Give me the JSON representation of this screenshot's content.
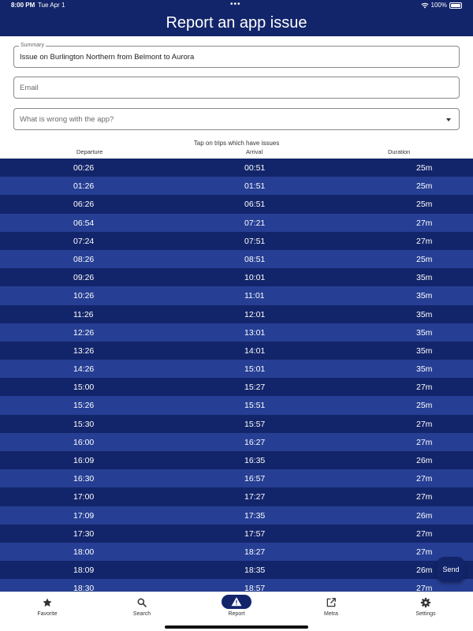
{
  "status_bar": {
    "time": "8:00 PM",
    "date": "Tue Apr 1",
    "dots": "•••",
    "battery": "100%"
  },
  "header": {
    "title": "Report an app issue"
  },
  "form": {
    "summary": {
      "label": "Summary",
      "value": "Issue on Burlington Northern from Belmont to Aurora"
    },
    "email": {
      "placeholder": "Email"
    },
    "issue": {
      "placeholder": "What is wrong with the app?"
    }
  },
  "trips": {
    "hint": "Tap on trips which have issues",
    "columns": {
      "departure": "Departure",
      "arrival": "Arrival",
      "duration": "Duration"
    },
    "rows": [
      {
        "departure": "00:26",
        "arrival": "00:51",
        "duration": "25m"
      },
      {
        "departure": "01:26",
        "arrival": "01:51",
        "duration": "25m"
      },
      {
        "departure": "06:26",
        "arrival": "06:51",
        "duration": "25m"
      },
      {
        "departure": "06:54",
        "arrival": "07:21",
        "duration": "27m"
      },
      {
        "departure": "07:24",
        "arrival": "07:51",
        "duration": "27m"
      },
      {
        "departure": "08:26",
        "arrival": "08:51",
        "duration": "25m"
      },
      {
        "departure": "09:26",
        "arrival": "10:01",
        "duration": "35m"
      },
      {
        "departure": "10:26",
        "arrival": "11:01",
        "duration": "35m"
      },
      {
        "departure": "11:26",
        "arrival": "12:01",
        "duration": "35m"
      },
      {
        "departure": "12:26",
        "arrival": "13:01",
        "duration": "35m"
      },
      {
        "departure": "13:26",
        "arrival": "14:01",
        "duration": "35m"
      },
      {
        "departure": "14:26",
        "arrival": "15:01",
        "duration": "35m"
      },
      {
        "departure": "15:00",
        "arrival": "15:27",
        "duration": "27m"
      },
      {
        "departure": "15:26",
        "arrival": "15:51",
        "duration": "25m"
      },
      {
        "departure": "15:30",
        "arrival": "15:57",
        "duration": "27m"
      },
      {
        "departure": "16:00",
        "arrival": "16:27",
        "duration": "27m"
      },
      {
        "departure": "16:09",
        "arrival": "16:35",
        "duration": "26m"
      },
      {
        "departure": "16:30",
        "arrival": "16:57",
        "duration": "27m"
      },
      {
        "departure": "17:00",
        "arrival": "17:27",
        "duration": "27m"
      },
      {
        "departure": "17:09",
        "arrival": "17:35",
        "duration": "26m"
      },
      {
        "departure": "17:30",
        "arrival": "17:57",
        "duration": "27m"
      },
      {
        "departure": "18:00",
        "arrival": "18:27",
        "duration": "27m"
      },
      {
        "departure": "18:09",
        "arrival": "18:35",
        "duration": "26m"
      },
      {
        "departure": "18:30",
        "arrival": "18:57",
        "duration": "27m"
      }
    ]
  },
  "send_button": {
    "label": "Send"
  },
  "bottom_nav": {
    "items": [
      {
        "label": "Favorite",
        "icon": "star-icon"
      },
      {
        "label": "Search",
        "icon": "search-icon"
      },
      {
        "label": "Report",
        "icon": "warning-icon",
        "active": true
      },
      {
        "label": "Metra",
        "icon": "external-link-icon"
      },
      {
        "label": "Settings",
        "icon": "gear-icon"
      }
    ]
  },
  "colors": {
    "primary": "#13256a",
    "row_alt": "#263f94"
  }
}
